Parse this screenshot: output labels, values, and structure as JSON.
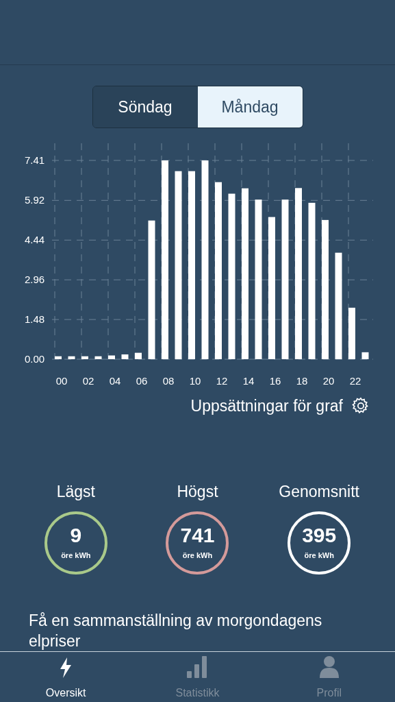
{
  "day_tabs": [
    {
      "label": "Söndag",
      "selected": false
    },
    {
      "label": "Måndag",
      "selected": true
    }
  ],
  "chart": {
    "chart_data": {
      "type": "bar",
      "x": [
        0,
        1,
        2,
        3,
        4,
        5,
        6,
        7,
        8,
        9,
        10,
        11,
        12,
        13,
        14,
        15,
        16,
        17,
        18,
        19,
        20,
        21,
        22,
        23
      ],
      "values": [
        0.11,
        0.11,
        0.11,
        0.11,
        0.14,
        0.18,
        0.24,
        5.17,
        7.41,
        7.01,
        7.01,
        7.41,
        6.6,
        6.17,
        6.37,
        5.95,
        5.3,
        5.95,
        6.38,
        5.83,
        5.19,
        3.97,
        1.92,
        0.26
      ],
      "xlim": [
        -0.5,
        23.5
      ],
      "ylim": [
        0,
        7.41
      ],
      "grid": true,
      "yticks": [
        {
          "value": 0,
          "label": "0.00"
        },
        {
          "value": 1.48,
          "label": "1.48"
        },
        {
          "value": 2.96,
          "label": "2.96"
        },
        {
          "value": 4.44,
          "label": "4.44"
        },
        {
          "value": 5.92,
          "label": "5.92"
        },
        {
          "value": 7.41,
          "label": "7.41"
        }
      ],
      "xticks": [
        {
          "value": 0,
          "label": "00"
        },
        {
          "value": 2,
          "label": "02"
        },
        {
          "value": 4,
          "label": "04"
        },
        {
          "value": 6,
          "label": "06"
        },
        {
          "value": 8,
          "label": "08"
        },
        {
          "value": 10,
          "label": "10"
        },
        {
          "value": 12,
          "label": "12"
        },
        {
          "value": 14,
          "label": "14"
        },
        {
          "value": 16,
          "label": "16"
        },
        {
          "value": 18,
          "label": "18"
        },
        {
          "value": 20,
          "label": "20"
        },
        {
          "value": 22,
          "label": "22"
        }
      ]
    },
    "settings_link": "Uppsättningar för graf"
  },
  "stats": [
    {
      "label": "Lägst",
      "value": "9",
      "unit": "öre kWh",
      "color": "#a9c98a"
    },
    {
      "label": "Högst",
      "value": "741",
      "unit": "öre kWh",
      "color": "#d49a9a"
    },
    {
      "label": "Genomsnitt",
      "value": "395",
      "unit": "öre kWh",
      "color": "#ffffff"
    }
  ],
  "promo": {
    "text": "Få en sammanställning av morgondagens elpriser"
  },
  "tab_bar": [
    {
      "kind": "bolt",
      "label": "Oversikt",
      "selected": true
    },
    {
      "kind": "bars",
      "label": "Statistikk",
      "selected": false
    },
    {
      "kind": "person",
      "label": "Profil",
      "selected": false
    }
  ]
}
